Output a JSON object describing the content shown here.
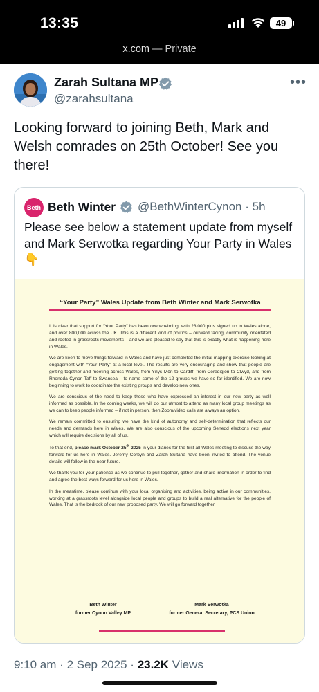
{
  "status_bar": {
    "time": "13:35",
    "battery": "49",
    "url_host": "x.com",
    "url_suffix": " — Private",
    "icons": [
      "signal-icon",
      "wifi-icon",
      "battery-icon"
    ]
  },
  "tweet": {
    "author_name": "Zarah Sultana MP",
    "author_handle": "@zarahsultana",
    "text": "Looking forward to joining Beth, Mark and Welsh comrades on 25th October! See you there!",
    "time": "9:10 am",
    "date": "2 Sep 2025",
    "views_count": "23.2K",
    "views_label": "Views",
    "separator": "·"
  },
  "quoted": {
    "avatar_label": "Beth",
    "author_name": "Beth Winter",
    "author_handle": "@BethWinterCynon",
    "age": "5h",
    "separator": "·",
    "text": "Please see below a statement update from myself and Mark Serwotka regarding Your Party in Wales",
    "emoji": "👇"
  },
  "document": {
    "title": "“Your Party” Wales Update from Beth Winter and Mark Serwotka",
    "p1": "It is clear that support for “Your Party” has been overwhelming, with 23,000 plus signed up in Wales alone, and over 800,000 across the UK. This is a different kind of politics – outward facing, community orientated and rooted in grassroots movements – and we are pleased to say that this is exactly what is happening here in Wales.",
    "p2": "We are keen to move things forward in Wales and have just completed the initial mapping exercise looking at engagement with “Your Party” at a local level. The results are very encouraging and show that people are getting together and meeting across Wales, from Ynys Môn to Cardiff; from Ceredigion to Clwyd, and from Rhondda Cynon Taff to Swansea – to name some of the 12 groups we have so far identified. We are now beginning to work to coordinate the existing groups and develop new ones.",
    "p3": "We are conscious of the need to keep those who have expressed an interest in our new party as well informed as possible. In the coming weeks, we will do our utmost to attend as many local group meetings as we can to keep people informed – if not in person, then Zoom/video calls are always an option.",
    "p4": "We remain committed to ensuring we have the kind of autonomy and self-determination that reflects our needs and demands here in Wales. We are also conscious of the upcoming Senedd elections next year which will require decisions by all of us.",
    "p5_pre": "To that end, ",
    "p5_bold": "please mark October 25",
    "p5_sup": "th",
    "p5_bold2": " 2025",
    "p5_post": " in your diaries for the first all-Wales meeting to discuss the way forward for us here in Wales. Jeremy Corbyn and Zarah Sultana have been invited to attend. The venue details will follow in the near future.",
    "p6": "We thank you for your patience as we continue to pull together, gather and share information in order to find and agree the best ways forward for us here in Wales.",
    "p7": "In the meantime, please continue with your local organising and activities, being active in our communities, working at a grassroots level alongside local people and groups to build a real alternative for the people of Wales. That is the bedrock of our new proposed party. We will go forward together.",
    "sig1_name": "Beth Winter",
    "sig1_role": "former Cynon Valley MP",
    "sig2_name": "Mark Serwotka",
    "sig2_role": "former General Secretary, PCS Union"
  },
  "colors": {
    "accent_pink": "#d8306c",
    "verified_blue": "#1d9bf0",
    "doc_background": "#fdfbe0"
  }
}
